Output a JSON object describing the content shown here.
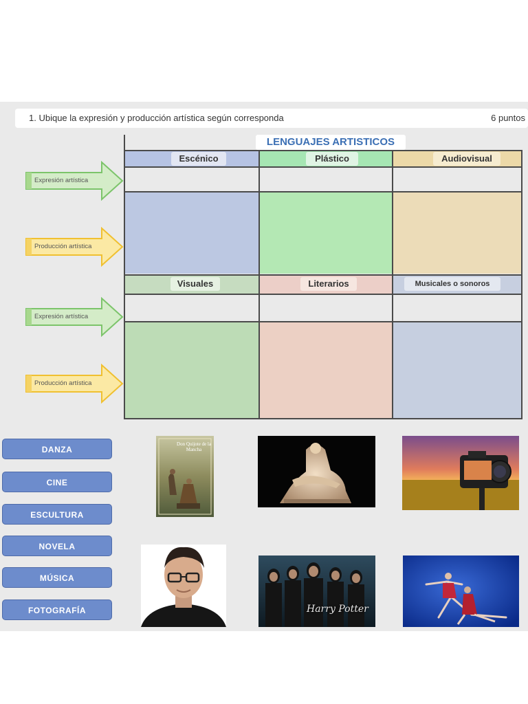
{
  "question": {
    "text": "1.  Ubique la expresión y producción artística según corresponda",
    "points": "6 puntos"
  },
  "table": {
    "title": "LENGUAJES ARTISTICOS",
    "row1_columns": [
      "Escénico",
      "Plástico",
      "Audiovisual"
    ],
    "row2_columns": [
      "Visuales",
      "Literarios",
      "Musicales o sonoros"
    ],
    "colors": {
      "escenico_header": "#b6c3e3",
      "plastico_header": "#a6e6b3",
      "audiovisual_header": "#ecd9a8",
      "escenico_body": "#bcc8e2",
      "plastico_body": "#b4e8b4",
      "audiovisual_body": "#ecdcb8",
      "visuales_header": "#c6dcc0",
      "literarios_header": "#eccfc8",
      "musicales_header": "#c7cfe0",
      "visuales_body": "#bddcb6",
      "literarios_body": "#ecd0c4",
      "musicales_body": "#c6cfe0"
    }
  },
  "arrows": {
    "expresion": "Expresión artística",
    "produccion": "Producción artística"
  },
  "words": [
    "DANZA",
    "CINE",
    "ESCULTURA",
    "NOVELA",
    "MÚSICA",
    "FOTOGRAFÍA"
  ],
  "images": {
    "book_title": "Don Quijote de la Mancha",
    "movie_logo": "Harry Potter"
  }
}
